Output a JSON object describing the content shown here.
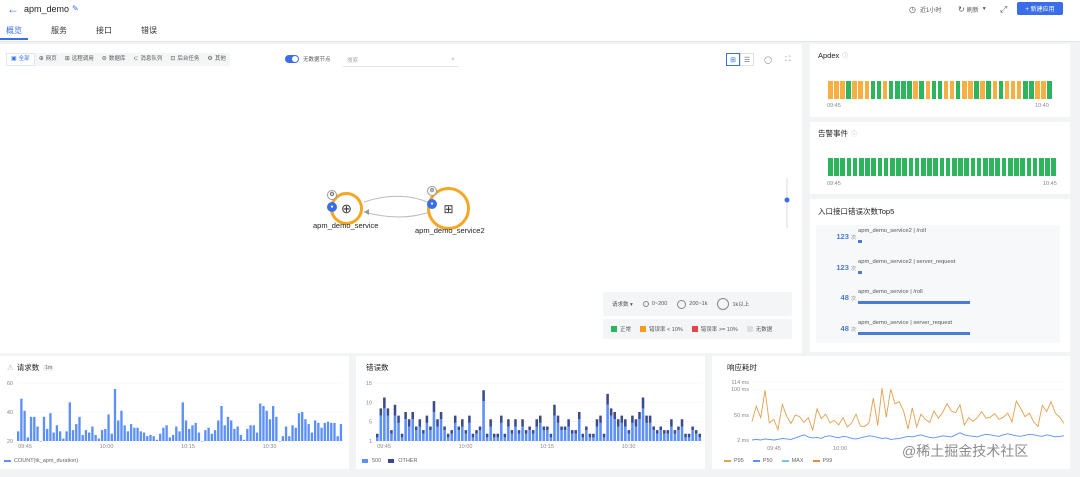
{
  "header": {
    "back_glyph": "←",
    "app_name": "apm_demo",
    "edit_icon": "pencil-icon",
    "tabs": [
      {
        "label": "概览",
        "active": true
      },
      {
        "label": "服务",
        "active": false
      },
      {
        "label": "接口",
        "active": false
      },
      {
        "label": "错误",
        "active": false
      }
    ],
    "time_range": "近1小时",
    "refresh": "刷新",
    "new_app_button": "+ 新建应用"
  },
  "topology": {
    "filters": [
      {
        "label": "全部",
        "icon": "layout-icon",
        "active": true
      },
      {
        "label": "网页",
        "icon": "globe-icon",
        "active": false
      },
      {
        "label": "远程调用",
        "icon": "remote-icon",
        "active": false
      },
      {
        "label": "数据库",
        "icon": "database-icon",
        "active": false
      },
      {
        "label": "消息队列",
        "icon": "queue-icon",
        "active": false
      },
      {
        "label": "后台任务",
        "icon": "task-icon",
        "active": false
      },
      {
        "label": "其他",
        "icon": "other-icon",
        "active": false
      }
    ],
    "no_data_toggle_label": "无数据节点",
    "search_placeholder": "搜索",
    "nodes": [
      {
        "name": "apm_demo_service"
      },
      {
        "name": "apm_demo_service2"
      }
    ],
    "size_legend": {
      "metric": "请求数",
      "ranges": [
        "0~200",
        "200~1k",
        "1k以上"
      ]
    },
    "status_legend": [
      {
        "label": "正常",
        "color": "#2db55d"
      },
      {
        "label": "错误率 < 10%",
        "color": "#f59a23"
      },
      {
        "label": "错误率 >= 10%",
        "color": "#e54545"
      },
      {
        "label": "无数据",
        "color": "#dcdee3"
      }
    ]
  },
  "apdex": {
    "title": "Apdex",
    "start": "09:45",
    "end": "10:40",
    "colors": [
      "#f5b041",
      "#f5b041",
      "#f5b041",
      "#2db55d",
      "#f5b041",
      "#f5b041",
      "#f5b041",
      "#2db55d",
      "#2db55d",
      "#f5b041",
      "#2db55d",
      "#2db55d",
      "#2db55d",
      "#2db55d",
      "#f5b041",
      "#2db55d",
      "#f5b041",
      "#2db55d",
      "#2db55d",
      "#f5b041",
      "#f5b041",
      "#2db55d",
      "#f5b041",
      "#f5b041",
      "#2db55d",
      "#f5b041",
      "#2db55d",
      "#f5b041",
      "#2db55d",
      "#f5b041",
      "#f5b041",
      "#f5b041",
      "#2db55d",
      "#2db55d",
      "#f5b041",
      "#f5b041",
      "#2db55d"
    ]
  },
  "alarms": {
    "title": "告警事件",
    "start": "09:45",
    "end": "10:45",
    "count": 37,
    "color": "#2db55d"
  },
  "top5": {
    "title": "入口接口错误次数Top5",
    "unit": "次",
    "items": [
      {
        "count": "123",
        "name": "apm_demo_service2 | /roll",
        "fraction": 0.02
      },
      {
        "count": "123",
        "name": "apm_demo_service2 | server_request",
        "fraction": 0.02
      },
      {
        "count": "48",
        "name": "apm_demo_service | /roll",
        "fraction": 0.56
      },
      {
        "count": "48",
        "name": "apm_demo_service | server_request",
        "fraction": 0.56
      }
    ]
  },
  "chart_data": [
    {
      "type": "bar",
      "title": "请求数",
      "badge": "1m",
      "y_ticks": [
        "60",
        "40",
        "20"
      ],
      "x_ticks": [
        "09:45",
        "10:00",
        "10:15",
        "10:30"
      ],
      "ylim": [
        20,
        68
      ],
      "series": [
        {
          "name": "COUNT(tk_apm_duration)",
          "color": "#5b8ff9",
          "values": [
            28,
            55,
            45,
            23,
            40,
            40,
            32,
            20,
            40,
            30,
            43,
            27,
            33,
            28,
            22,
            28,
            52,
            29,
            34,
            40,
            25,
            29,
            27,
            32,
            25,
            22,
            29,
            30,
            42,
            26,
            63,
            37,
            45,
            33,
            28,
            34,
            31,
            31,
            28,
            27,
            24,
            25,
            24,
            21,
            26,
            31,
            33,
            23,
            25,
            32,
            28,
            52,
            37,
            30,
            33,
            35,
            27,
            20,
            29,
            31,
            26,
            29,
            37,
            49,
            33,
            40,
            37,
            30,
            32,
            25,
            21,
            30,
            33,
            33,
            27,
            51,
            49,
            45,
            38,
            49,
            40,
            20,
            24,
            32,
            24,
            33,
            31,
            43,
            44,
            38,
            34,
            27,
            37,
            35,
            31,
            35,
            36,
            35,
            35,
            24,
            34
          ]
        }
      ]
    },
    {
      "type": "bar",
      "stacked": true,
      "title": "错误数",
      "y_ticks": [
        "15",
        "10",
        "5",
        "1"
      ],
      "x_ticks": [
        "09:45",
        "10:00",
        "10:15",
        "10:30"
      ],
      "ylim": [
        0,
        16
      ],
      "series": [
        {
          "name": "500",
          "color": "#5b8ff9",
          "values": [
            1,
            7,
            9,
            7,
            2,
            7,
            5,
            1,
            6,
            4,
            6,
            3,
            4,
            2,
            5,
            3,
            8,
            4,
            6,
            3,
            1,
            2,
            5,
            3,
            4,
            2,
            5,
            1,
            2,
            3,
            11,
            1,
            4,
            1,
            1,
            5,
            1,
            4,
            2,
            4,
            2,
            4,
            2,
            3,
            2,
            4,
            5,
            3,
            3,
            1,
            7,
            5,
            3,
            3,
            4,
            2,
            2,
            6,
            1,
            3,
            1,
            1,
            4,
            5,
            1,
            10,
            7,
            6,
            4,
            5,
            4,
            2,
            5,
            4,
            6,
            9,
            5,
            5,
            3,
            2,
            3,
            2,
            2,
            4,
            2,
            3,
            4,
            1,
            1,
            3,
            2,
            1
          ]
        },
        {
          "name": "OTHER",
          "color": "#3d4a8a",
          "values": [
            1,
            2,
            3,
            2,
            1,
            3,
            2,
            1,
            2,
            2,
            2,
            1,
            2,
            1,
            2,
            1,
            3,
            2,
            2,
            1,
            1,
            1,
            2,
            1,
            2,
            1,
            2,
            1,
            1,
            1,
            3,
            1,
            2,
            1,
            1,
            2,
            1,
            2,
            1,
            2,
            1,
            2,
            1,
            1,
            1,
            2,
            2,
            1,
            1,
            1,
            3,
            2,
            1,
            1,
            2,
            1,
            1,
            2,
            1,
            1,
            1,
            1,
            2,
            2,
            1,
            3,
            2,
            2,
            2,
            2,
            2,
            1,
            2,
            2,
            2,
            3,
            2,
            2,
            1,
            1,
            1,
            1,
            1,
            2,
            1,
            1,
            2,
            1,
            1,
            1,
            1,
            1
          ]
        }
      ]
    },
    {
      "type": "line",
      "title": "响应耗时",
      "y_ticks": [
        "114 ms",
        "100 ms",
        "50 ms",
        "2 ms"
      ],
      "x_ticks": [
        "09:45",
        "10:00"
      ],
      "ylim": [
        0,
        114
      ],
      "series": [
        {
          "name": "P95",
          "color": "#e3a04f",
          "values": [
            38,
            67,
            45,
            98,
            35,
            42,
            22,
            71,
            48,
            34,
            50,
            47,
            36,
            45,
            21,
            62,
            43,
            52,
            35,
            40,
            31,
            45,
            27,
            35,
            52,
            29,
            28,
            35,
            83,
            30,
            102,
            46,
            100,
            72,
            76,
            57,
            23,
            64,
            27,
            52,
            42,
            36,
            58,
            44,
            55,
            72,
            58,
            55,
            70,
            31,
            45,
            38,
            45,
            57,
            44,
            46,
            53,
            42,
            46,
            54,
            37,
            77,
            63,
            47,
            54,
            37,
            28,
            69,
            57,
            76,
            54,
            46,
            34
          ]
        },
        {
          "name": "P50",
          "color": "#5b8ff9",
          "values": [
            2,
            3,
            2,
            4,
            3,
            2,
            3,
            5,
            4,
            3,
            6,
            9,
            12,
            8,
            6,
            7,
            5,
            9,
            10,
            8,
            6,
            9,
            8,
            5,
            4,
            6,
            8,
            10,
            9,
            7,
            5,
            6,
            3,
            4,
            5,
            7,
            9,
            8,
            10,
            12,
            9,
            7,
            6,
            8,
            10,
            9,
            8,
            12,
            16,
            12,
            10,
            9,
            8,
            11,
            13,
            12,
            10,
            9,
            12,
            14,
            12,
            10,
            9,
            11,
            13,
            12,
            10,
            9,
            12,
            10,
            8,
            9,
            10
          ]
        },
        {
          "name": "MAX",
          "color": "#76c5ef",
          "values": []
        },
        {
          "name": "P99",
          "color": "#e58a3d",
          "values": []
        }
      ]
    }
  ],
  "watermark": "@稀土掘金技术社区"
}
